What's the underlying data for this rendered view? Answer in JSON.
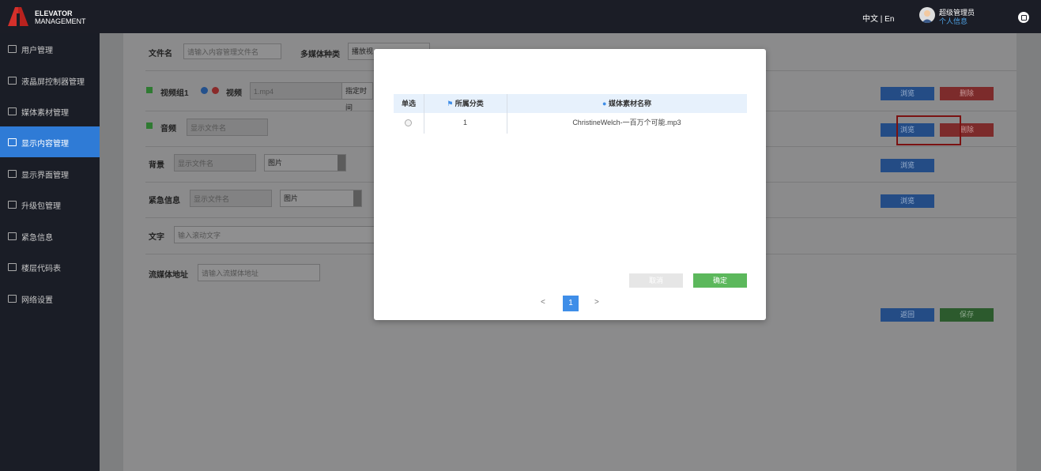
{
  "app": {
    "logo_line1": "ELEVATOR",
    "logo_line2": "MANAGEMENT",
    "lang": "中文 | En",
    "user_name": "超级管理员",
    "user_info": "个人信息"
  },
  "sidebar": {
    "items": [
      {
        "label": "用户管理",
        "icon": "user-icon"
      },
      {
        "label": "液晶屏控制器管理",
        "icon": "sliders-icon"
      },
      {
        "label": "媒体素材管理",
        "icon": "media-icon"
      },
      {
        "label": "显示内容管理",
        "icon": "grid-icon",
        "active": true
      },
      {
        "label": "显示界面管理",
        "icon": "display-icon"
      },
      {
        "label": "升级包管理",
        "icon": "upgrade-icon"
      },
      {
        "label": "紧急信息",
        "icon": "warning-icon"
      },
      {
        "label": "楼层代码表",
        "icon": "floor-icon"
      },
      {
        "label": "网络设置",
        "icon": "network-icon"
      }
    ]
  },
  "form": {
    "filename_label": "文件名",
    "filename_placeholder": "请输入内容管理文件名",
    "media_type_label": "多媒体种类",
    "media_type_value": "播放视",
    "video_group_label": "视频组1",
    "video_label": "视频",
    "video_value": "1.mp4",
    "video_time": "指定时间",
    "audio_label": "音频",
    "audio_placeholder": "显示文件名",
    "bg_label": "背景",
    "bg_placeholder": "显示文件名",
    "bg_select": "图片",
    "urgent_label": "紧急信息",
    "urgent_placeholder": "显示文件名",
    "urgent_select": "图片",
    "text_label": "文字",
    "text_placeholder": "输入滚动文字",
    "stream_label": "流媒体地址",
    "stream_placeholder": "请输入流媒体地址",
    "browse": "浏览",
    "delete": "删除",
    "back": "返回",
    "save": "保存"
  },
  "modal": {
    "col_select": "单选",
    "col_category": "所属分类",
    "col_name": "媒体素材名称",
    "rows": [
      {
        "category": "1",
        "name": "ChristineWelch-一百万个可能.mp3"
      }
    ],
    "cancel": "取消",
    "confirm": "确定",
    "prev": "<",
    "page": "1",
    "next": ">"
  },
  "colors": {
    "accent": "#2f7bd6",
    "confirm": "#5cb85c",
    "delete": "#d9534f"
  }
}
